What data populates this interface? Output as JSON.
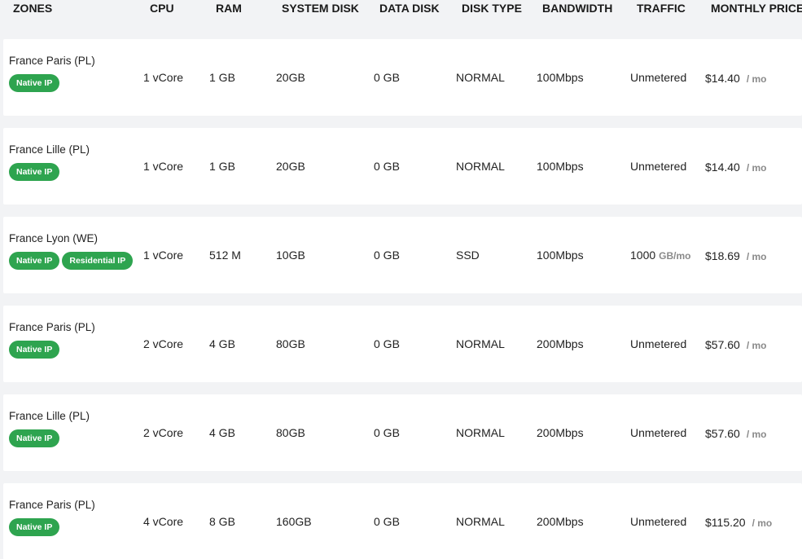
{
  "headers": {
    "zones": "ZONES",
    "cpu": "CPU",
    "ram": "RAM",
    "system_disk": "SYSTEM DISK",
    "data_disk": "DATA DISK",
    "disk_type": "DISK TYPE",
    "bandwidth": "BANDWIDTH",
    "traffic": "TRAFFIC",
    "monthly_price": "MONTHLY PRICE"
  },
  "price_suffix": "/ mo",
  "colors": {
    "badge_green": "#2ea44f",
    "row_bg": "#ffffff",
    "page_bg": "#f2f3f5"
  },
  "plans": [
    {
      "zone": "France Paris (PL)",
      "badges": [
        "Native IP"
      ],
      "cpu": "1 vCore",
      "ram": "1 GB",
      "system_disk": "20GB",
      "data_disk": "0 GB",
      "disk_type": "NORMAL",
      "bandwidth": "100Mbps",
      "traffic": "Unmetered",
      "traffic_unit": "",
      "price": "$14.40"
    },
    {
      "zone": "France Lille (PL)",
      "badges": [
        "Native IP"
      ],
      "cpu": "1 vCore",
      "ram": "1 GB",
      "system_disk": "20GB",
      "data_disk": "0 GB",
      "disk_type": "NORMAL",
      "bandwidth": "100Mbps",
      "traffic": "Unmetered",
      "traffic_unit": "",
      "price": "$14.40"
    },
    {
      "zone": "France Lyon (WE)",
      "badges": [
        "Native IP",
        "Residential IP"
      ],
      "cpu": "1 vCore",
      "ram": "512 M",
      "system_disk": "10GB",
      "data_disk": "0 GB",
      "disk_type": "SSD",
      "bandwidth": "100Mbps",
      "traffic": "1000",
      "traffic_unit": "GB/mo",
      "price": "$18.69"
    },
    {
      "zone": "France Paris (PL)",
      "badges": [
        "Native IP"
      ],
      "cpu": "2 vCore",
      "ram": "4 GB",
      "system_disk": "80GB",
      "data_disk": "0 GB",
      "disk_type": "NORMAL",
      "bandwidth": "200Mbps",
      "traffic": "Unmetered",
      "traffic_unit": "",
      "price": "$57.60"
    },
    {
      "zone": "France Lille (PL)",
      "badges": [
        "Native IP"
      ],
      "cpu": "2 vCore",
      "ram": "4 GB",
      "system_disk": "80GB",
      "data_disk": "0 GB",
      "disk_type": "NORMAL",
      "bandwidth": "200Mbps",
      "traffic": "Unmetered",
      "traffic_unit": "",
      "price": "$57.60"
    },
    {
      "zone": "France Paris (PL)",
      "badges": [
        "Native IP"
      ],
      "cpu": "4 vCore",
      "ram": "8 GB",
      "system_disk": "160GB",
      "data_disk": "0 GB",
      "disk_type": "NORMAL",
      "bandwidth": "200Mbps",
      "traffic": "Unmetered",
      "traffic_unit": "",
      "price": "$115.20"
    }
  ]
}
